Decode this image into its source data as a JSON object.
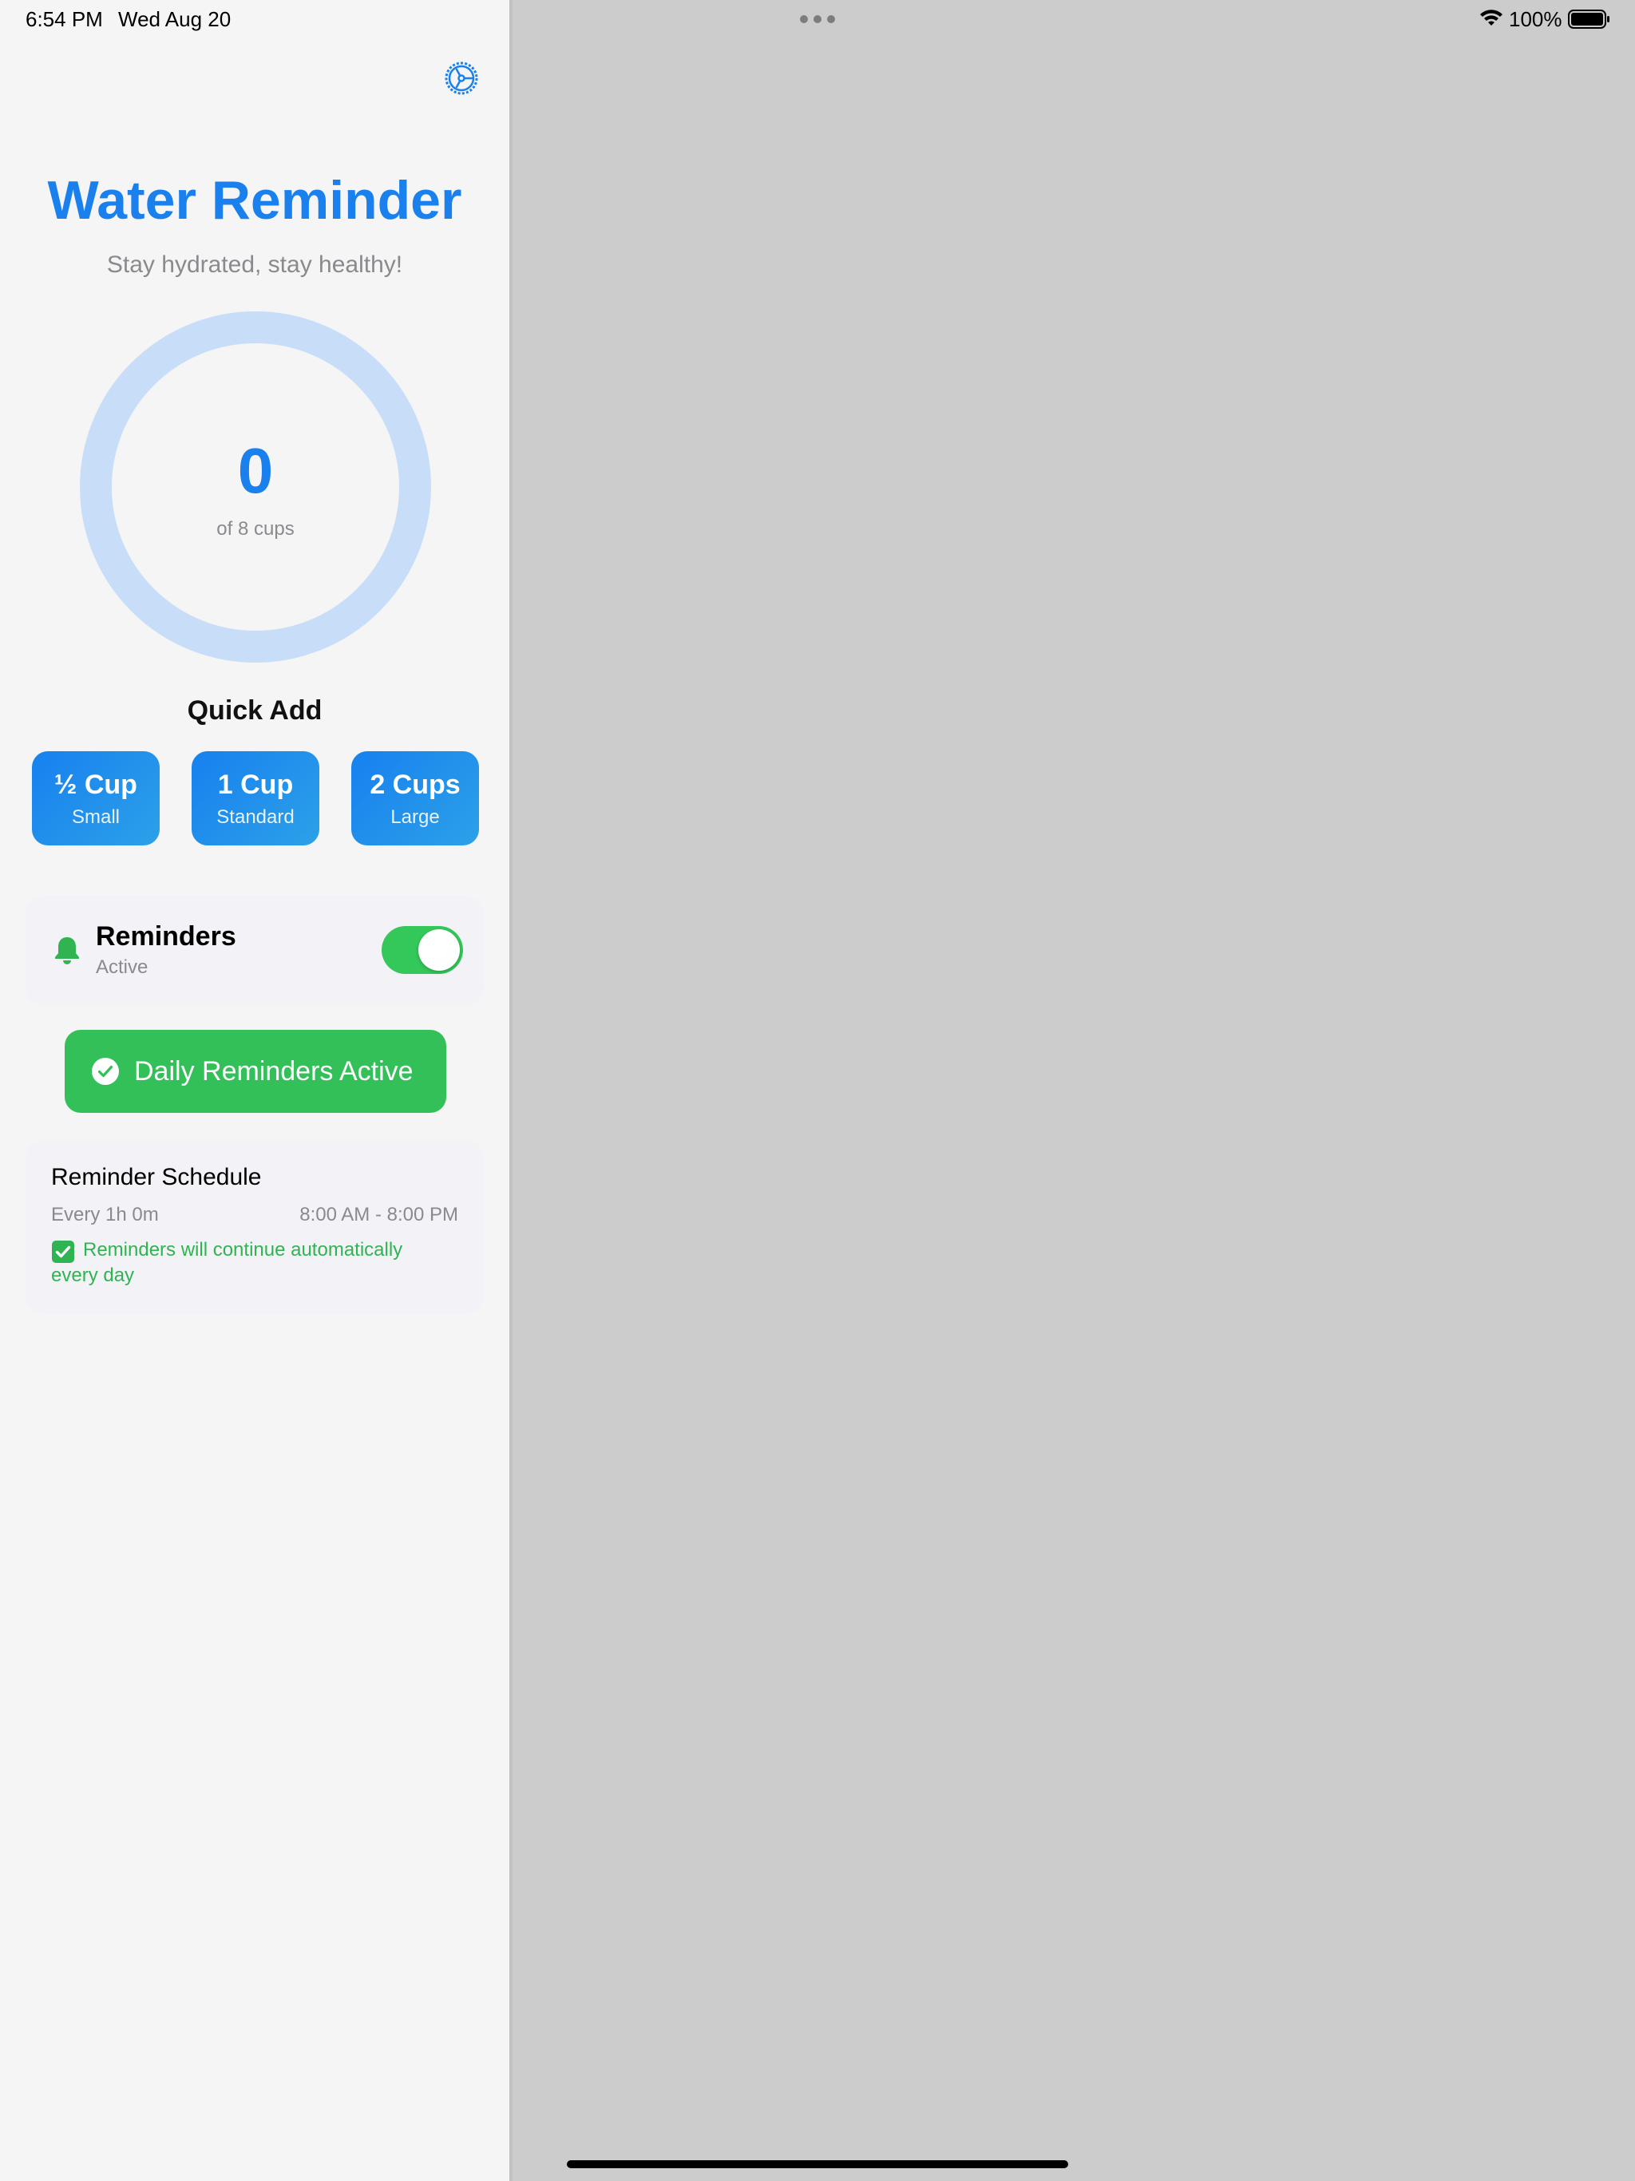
{
  "status_bar": {
    "time": "6:54 PM",
    "date": "Wed Aug 20",
    "battery_percent": "100%",
    "wifi_icon": "wifi-icon",
    "battery_icon": "battery-full-icon"
  },
  "app": {
    "title": "Water Reminder",
    "subtitle": "Stay hydrated, stay healthy!",
    "settings_icon": "gear-icon",
    "accent_color": "#1a80ee"
  },
  "progress": {
    "count": "0",
    "goal_text": "of 8 cups",
    "fraction": 0,
    "ring_track_color": "#c8def8"
  },
  "quick_add": {
    "heading": "Quick Add",
    "buttons": [
      {
        "label": "½ Cup",
        "sub": "Small"
      },
      {
        "label": "1 Cup",
        "sub": "Standard"
      },
      {
        "label": "2 Cups",
        "sub": "Large"
      }
    ]
  },
  "reminders": {
    "icon": "bell-icon",
    "title": "Reminders",
    "status": "Active",
    "toggle_on": true,
    "toggle_color": "#34c759"
  },
  "daily_button": {
    "icon": "checkmark-circle-icon",
    "label": "Daily Reminders Active",
    "color": "#34c059"
  },
  "schedule": {
    "title": "Reminder Schedule",
    "interval": "Every 1h 0m",
    "hours": "8:00 AM - 8:00 PM",
    "note_icon": "check-box-icon",
    "note": "Reminders will continue automatically every day"
  }
}
